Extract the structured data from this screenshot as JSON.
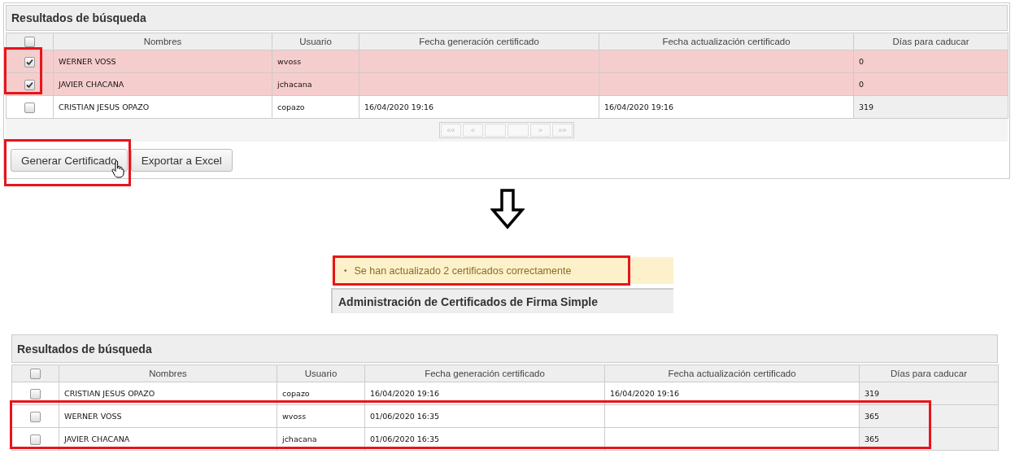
{
  "before": {
    "title": "Resultados de búsqueda",
    "columns": [
      "Nombres",
      "Usuario",
      "Fecha generación certificado",
      "Fecha actualización certificado",
      "Días para caducar"
    ],
    "header_checked": false,
    "rows": [
      {
        "checked": true,
        "selected": true,
        "cells": [
          "WERNER VOSS",
          "wvoss",
          "",
          "",
          "0"
        ]
      },
      {
        "checked": true,
        "selected": true,
        "cells": [
          "JAVIER CHACANA",
          "jchacana",
          "",
          "",
          "0"
        ]
      },
      {
        "checked": false,
        "selected": false,
        "cells": [
          "CRISTIAN JESUS OPAZO",
          "copazo",
          "16/04/2020 19:16",
          "16/04/2020 19:16",
          "319"
        ]
      }
    ],
    "pager": {
      "first": "««",
      "prev": "«",
      "next": "»",
      "last": "»»"
    },
    "buttons": [
      "Generar Certificado",
      "Exportar a Excel"
    ]
  },
  "message": {
    "bullet": "•",
    "text": "Se han actualizado 2 certificados correctamente"
  },
  "section_title": "Administración de Certificados de Firma Simple",
  "after": {
    "title": "Resultados de búsqueda",
    "columns": [
      "Nombres",
      "Usuario",
      "Fecha generación certificado",
      "Fecha actualización certificado",
      "Días para caducar"
    ],
    "header_checked": false,
    "rows": [
      {
        "checked": false,
        "selected": false,
        "cells": [
          "CRISTIAN JESUS OPAZO",
          "copazo",
          "16/04/2020 19:16",
          "16/04/2020 19:16",
          "319"
        ]
      },
      {
        "checked": false,
        "selected": false,
        "cells": [
          "WERNER VOSS",
          "wvoss",
          "01/06/2020 16:35",
          "",
          "365"
        ]
      },
      {
        "checked": false,
        "selected": false,
        "cells": [
          "JAVIER CHACANA",
          "jchacana",
          "01/06/2020 16:35",
          "",
          "365"
        ]
      }
    ]
  }
}
